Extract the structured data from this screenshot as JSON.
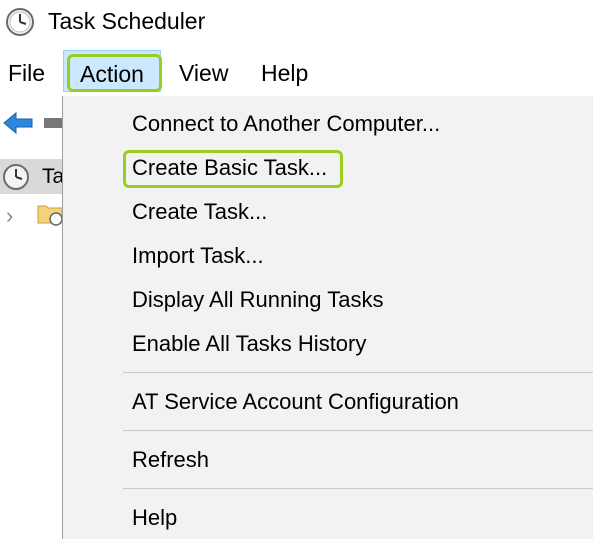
{
  "window": {
    "title": "Task Scheduler",
    "icon": "clock-icon"
  },
  "menubar": {
    "file": "File",
    "action": "Action",
    "view": "View",
    "help": "Help"
  },
  "tree": {
    "root_label_visible": "Ta",
    "root_icon": "clock-icon",
    "child_icon": "folder-clock-icon"
  },
  "toolbar": {
    "back_icon": "back-arrow-icon"
  },
  "action_menu": {
    "items": [
      "Connect to Another Computer...",
      "Create Basic Task...",
      "Create Task...",
      "Import Task...",
      "Display All Running Tasks",
      "Enable All Tasks History",
      "AT Service Account Configuration",
      "Refresh",
      "Help"
    ]
  },
  "colors": {
    "highlight_outline": "#9acd1f",
    "menu_active_bg": "#cce8ff",
    "menu_bg": "#f2f2f2"
  }
}
